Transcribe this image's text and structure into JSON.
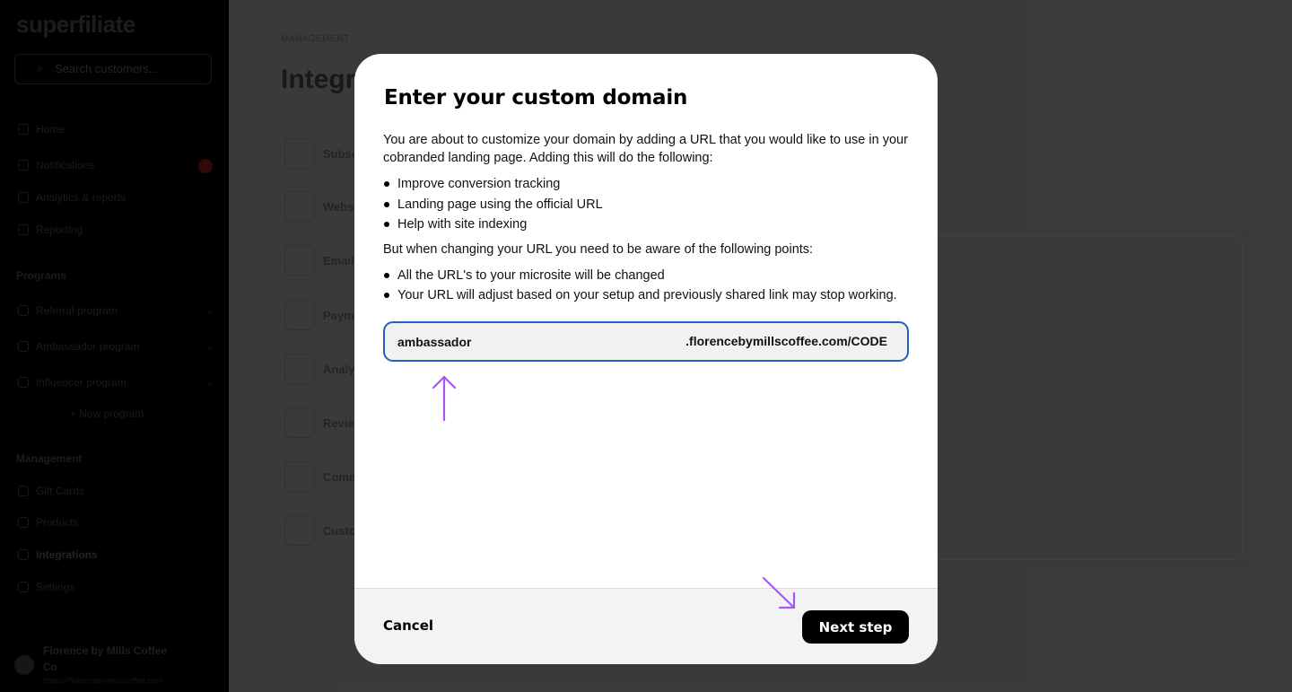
{
  "sidebar": {
    "logo": "superfiliate",
    "search_placeholder": "Search customers...",
    "items": [
      {
        "label": "Home"
      },
      {
        "label": "Notifications"
      },
      {
        "label": "Analytics & reports"
      },
      {
        "label": "Reporting"
      }
    ],
    "programs_label": "Programs",
    "programs": [
      {
        "label": "Referral program"
      },
      {
        "label": "Ambassador program"
      },
      {
        "label": "Influencer program"
      }
    ],
    "new_program": "+ New program",
    "management_label": "Management",
    "management": [
      {
        "label": "Gift Cards"
      },
      {
        "label": "Products"
      },
      {
        "label": "Integrations"
      },
      {
        "label": "Settings"
      }
    ],
    "account_name": "Florence by Mills Coffee Co",
    "account_sub": "https://florencebymillscoffee.com"
  },
  "main": {
    "breadcrumb": "MANAGEMENT",
    "title": "Integrations",
    "integrations": [
      {
        "label": "Subscriptions"
      },
      {
        "label": "Website"
      },
      {
        "label": "Email"
      },
      {
        "label": "Payments"
      },
      {
        "label": "Analytics"
      },
      {
        "label": "Reviews"
      },
      {
        "label": "Commerce"
      },
      {
        "label": "Custom domain"
      }
    ]
  },
  "modal": {
    "title": "Enter your custom domain",
    "intro": "You are about to customize your domain by adding a URL that you would like to use in your cobranded landing page. Adding this will do the following:",
    "benefits": [
      "Improve conversion tracking",
      "Landing page using the official URL",
      "Help with site indexing"
    ],
    "warning_intro": "But when changing your URL you need to be aware of the following points:",
    "warnings": [
      "All the URL's to your microsite will be changed",
      "Your URL will adjust based on your setup and previously shared link may stop working."
    ],
    "domain_value": "ambassador",
    "domain_suffix": ".florencebymillscoffee.com/CODE",
    "cancel_label": "Cancel",
    "next_label": "Next step"
  },
  "colors": {
    "accent_blue": "#2160c4",
    "annotation_purple": "#a855f7",
    "button_black": "#000000"
  }
}
